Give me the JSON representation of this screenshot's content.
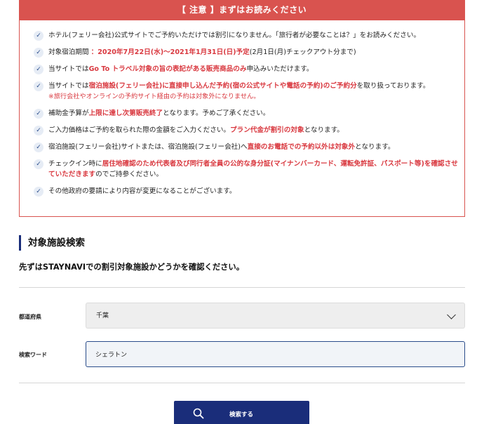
{
  "notice": {
    "header": "【 注意 】まずはお読みください",
    "items": [
      {
        "segments": [
          {
            "t": "ホテル(フェリー会社)公式サイトでご予約いただけでは割引になりません。「旅行者が必要なことは？」をお読みください。",
            "red": false
          }
        ]
      },
      {
        "segments": [
          {
            "t": "対象宿泊期間 ",
            "red": false
          },
          {
            "t": "：2020年7月22日(水)～2021年1月31日(日)予定",
            "red": true
          },
          {
            "t": "(2月1日(月)チェックアウト分まで)",
            "red": false
          }
        ]
      },
      {
        "segments": [
          {
            "t": "当サイトでは",
            "red": false
          },
          {
            "t": "Go To トラベル対象の旨の表記がある販売商品のみ",
            "red": true
          },
          {
            "t": "申込みいただけます。",
            "red": false
          }
        ]
      },
      {
        "segments": [
          {
            "t": "当サイトでは",
            "red": false
          },
          {
            "t": "宿泊施設(フェリー会社)に直接申し込んだ予約(宿の公式サイトや電話の予約)のご予約分",
            "red": true
          },
          {
            "t": "を取り扱っております。",
            "red": false
          }
        ],
        "note": "※旅行会社やオンラインの予約サイト経由の予約は対象外になりません。"
      },
      {
        "segments": [
          {
            "t": "補助金予算が",
            "red": false
          },
          {
            "t": "上限に達し次第販売終了",
            "red": true
          },
          {
            "t": "となります。予めご了承ください。",
            "red": false
          }
        ]
      },
      {
        "segments": [
          {
            "t": "ご入力価格はご予約を取られた際の金額をご入力ください。",
            "red": false
          },
          {
            "t": "プラン代金が割引の対象",
            "red": true
          },
          {
            "t": "となります。",
            "red": false
          }
        ]
      },
      {
        "segments": [
          {
            "t": "宿泊施設(フェリー会社)サイトまたは、宿泊施設(フェリー会社)へ",
            "red": false
          },
          {
            "t": "直接のお電話での予約以外は対象外",
            "red": true
          },
          {
            "t": "となります。",
            "red": false
          }
        ]
      },
      {
        "segments": [
          {
            "t": "チェックイン時に",
            "red": false
          },
          {
            "t": "居住地確認のため代表者及び同行者全員の公的な身分証(マイナンバーカード、運転免許証、パスポート等)を確認させていただきます",
            "red": true
          },
          {
            "t": "のでご持参ください。",
            "red": false
          }
        ]
      },
      {
        "segments": [
          {
            "t": "その他政府の要請により内容が変更になることがございます。",
            "red": false
          }
        ]
      }
    ]
  },
  "search": {
    "heading": "対象施設検索",
    "lead": "先ずはSTAYNAVIでの割引対象施設かどうかを確認ください。",
    "prefecture_label": "都道府県",
    "prefecture_value": "千葉",
    "keyword_label": "検索ワード",
    "keyword_value": "シェラトン",
    "button_label": "検索する"
  },
  "colors": {
    "accent_red": "#d9534f",
    "navy": "#1a2d7a"
  },
  "icons": {
    "check": "check-icon",
    "chevron": "chevron-down-icon",
    "search": "search-icon"
  }
}
